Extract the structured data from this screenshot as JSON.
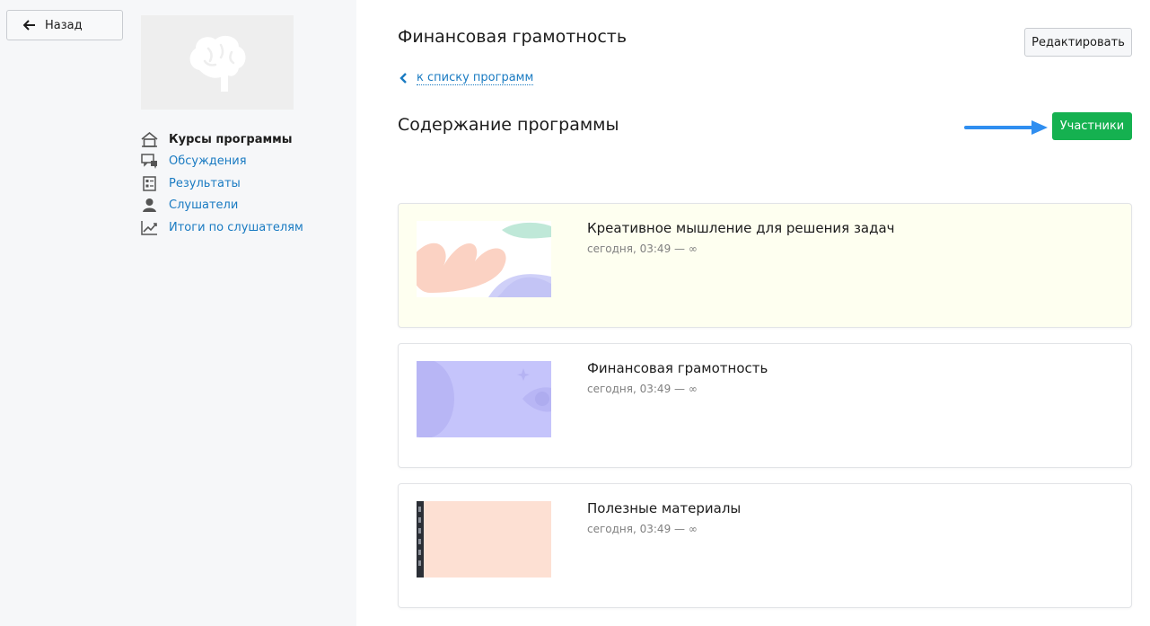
{
  "sidebar": {
    "back_label": "Назад",
    "nav": [
      {
        "label": "Курсы программы",
        "icon": "home-icon",
        "active": true
      },
      {
        "label": "Обсуждения",
        "icon": "chat-icon",
        "active": false
      },
      {
        "label": "Результаты",
        "icon": "report-icon",
        "active": false
      },
      {
        "label": "Слушатели",
        "icon": "user-icon",
        "active": false
      },
      {
        "label": "Итоги по слушателям",
        "icon": "chart-line-icon",
        "active": false
      }
    ]
  },
  "header": {
    "title": "Финансовая грамотность",
    "edit_label": "Редактировать",
    "back_link": "к списку программ"
  },
  "content": {
    "section_title": "Содержание программы",
    "participants_label": "Участники",
    "courses": [
      {
        "name": "Креативное мышление для решения задач",
        "dates": "сегодня, 03:49 — ∞"
      },
      {
        "name": "Финансовая грамотность",
        "dates": "сегодня, 03:49 — ∞"
      },
      {
        "name": "Полезные материалы",
        "dates": "сегодня, 03:49 — ∞"
      }
    ]
  },
  "colors": {
    "accent_green": "#15b150",
    "link_blue": "#1a7bc2",
    "pointer_blue": "#2f8ef0",
    "highlight_card": "#fefff0"
  }
}
